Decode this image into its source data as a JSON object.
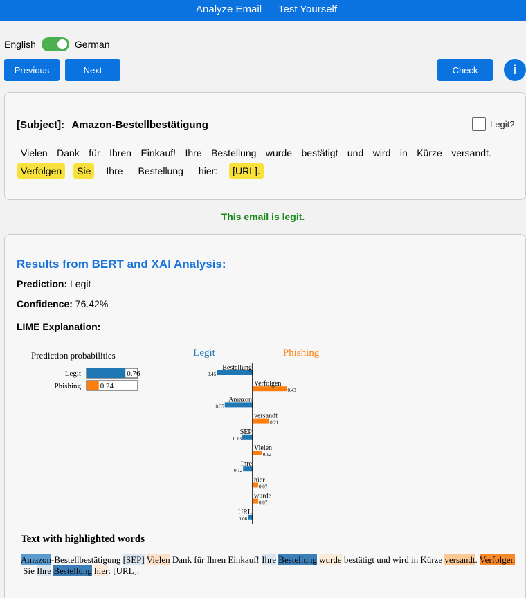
{
  "nav": {
    "analyze": "Analyze Email",
    "test": "Test Yourself"
  },
  "language": {
    "left": "English",
    "right": "German"
  },
  "buttons": {
    "previous": "Previous",
    "next": "Next",
    "check": "Check",
    "info": "i"
  },
  "email": {
    "subject_label": "[Subject]:",
    "subject": "Amazon-Bestellbestätigung",
    "legit_label": "Legit?",
    "line1": [
      "Vielen",
      "Dank",
      "für",
      "Ihren",
      "Einkauf!",
      "Ihre",
      "Bestellung",
      "wurde",
      "bestätigt",
      "und",
      "wird",
      "in",
      "Kürze",
      "versandt."
    ],
    "line2": [
      {
        "text": "Verfolgen",
        "hl": true
      },
      {
        "text": "Sie",
        "hl": true
      },
      {
        "text": "Ihre",
        "hl": false
      },
      {
        "text": "Bestellung",
        "hl": false
      },
      {
        "text": "hier:",
        "hl": false
      },
      {
        "text": "[URL].",
        "hl": true
      }
    ]
  },
  "verdict": "This email is legit.",
  "results": {
    "title": "Results from BERT and XAI Analysis:",
    "prediction_label": "Prediction:",
    "prediction_value": "Legit",
    "confidence_label": "Confidence:",
    "confidence_value": "76.42%",
    "lime_label": "LIME Explanation:"
  },
  "colors": {
    "legit": "#1f77b4",
    "phishing": "#ff7f0e"
  },
  "chart_data": {
    "type": "bar",
    "probabilities": {
      "title": "Prediction probabilities",
      "classes": [
        "Legit",
        "Phishing"
      ],
      "values": [
        0.76,
        0.24
      ],
      "labels": [
        "0.76",
        "0.24"
      ]
    },
    "weights": {
      "left_label": "Legit",
      "right_label": "Phishing",
      "features": [
        {
          "word": "Bestellung",
          "value": 0.45,
          "label": "0.45",
          "cls": "legit"
        },
        {
          "word": "Verfolgen",
          "value": 0.43,
          "label": "0.43",
          "cls": "phishing"
        },
        {
          "word": "Amazon",
          "value": 0.35,
          "label": "0.35",
          "cls": "legit"
        },
        {
          "word": "versandt",
          "value": 0.21,
          "label": "0.21",
          "cls": "phishing"
        },
        {
          "word": "SEP",
          "value": 0.13,
          "label": "0.13",
          "cls": "legit"
        },
        {
          "word": "Vielen",
          "value": 0.12,
          "label": "0.12",
          "cls": "phishing"
        },
        {
          "word": "Ihre",
          "value": 0.12,
          "label": "0.12",
          "cls": "legit"
        },
        {
          "word": "hier",
          "value": 0.07,
          "label": "0.07",
          "cls": "phishing"
        },
        {
          "word": "wurde",
          "value": 0.07,
          "label": "0.07",
          "cls": "phishing"
        },
        {
          "word": "URL",
          "value": 0.06,
          "label": "0.06",
          "cls": "legit"
        }
      ]
    }
  },
  "highlighted": {
    "title": "Text with highlighted words",
    "tokens": [
      {
        "t": "Amazon",
        "bg": "#5a9bd0"
      },
      {
        "t": "-Bestellbestätigung ",
        "bg": ""
      },
      {
        "t": "[SEP]",
        "bg": "#d9e6f2"
      },
      {
        "t": " ",
        "bg": ""
      },
      {
        "t": "Vielen",
        "bg": "#fde0c5"
      },
      {
        "t": " Dank für Ihren Einkauf! ",
        "bg": ""
      },
      {
        "t": "Ihre",
        "bg": "#d9e6f2"
      },
      {
        "t": " ",
        "bg": ""
      },
      {
        "t": "Bestellung",
        "bg": "#3c7fb8"
      },
      {
        "t": " ",
        "bg": ""
      },
      {
        "t": "wurde",
        "bg": "#fdebd9"
      },
      {
        "t": " bestätigt und wird in Kürze ",
        "bg": ""
      },
      {
        "t": "versandt",
        "bg": "#fcc895"
      },
      {
        "t": ". ",
        "bg": ""
      },
      {
        "t": "Verfolgen",
        "bg": "#f8892a"
      },
      {
        "t": " Sie ",
        "bg": ""
      },
      {
        "t": "Ihre",
        "bg": "#d9e6f2"
      },
      {
        "t": " ",
        "bg": ""
      },
      {
        "t": "Bestellung",
        "bg": "#3c7fb8"
      },
      {
        "t": " ",
        "bg": ""
      },
      {
        "t": "hier",
        "bg": "#fdebd9"
      },
      {
        "t": ": [URL].",
        "bg": ""
      }
    ]
  }
}
